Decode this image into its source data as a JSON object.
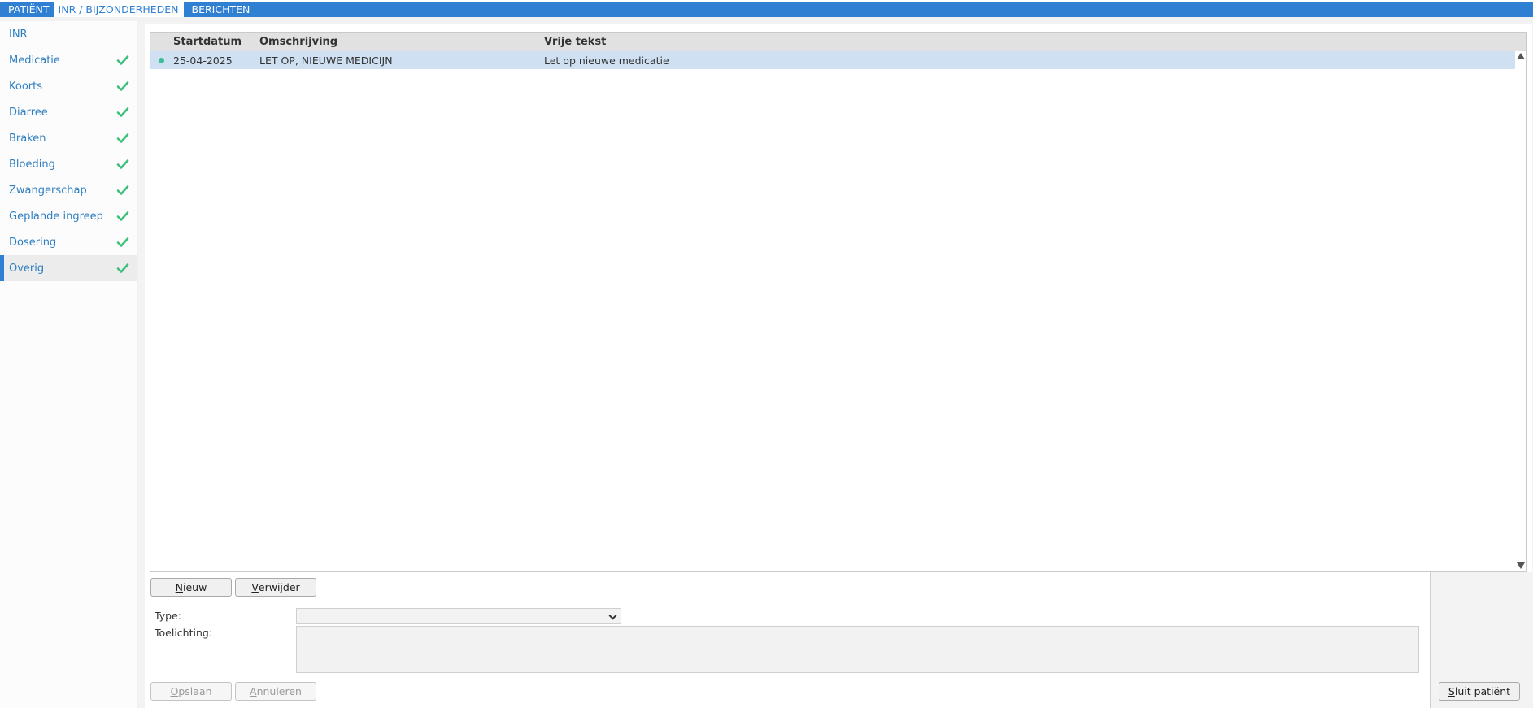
{
  "tabs": [
    {
      "label": "PATIËNT"
    },
    {
      "label": "INR / BIJZONDERHEDEN"
    },
    {
      "label": "BERICHTEN"
    }
  ],
  "sidebar": {
    "items": [
      {
        "label": "INR",
        "checked": false
      },
      {
        "label": "Medicatie",
        "checked": true
      },
      {
        "label": "Koorts",
        "checked": true
      },
      {
        "label": "Diarree",
        "checked": true
      },
      {
        "label": "Braken",
        "checked": true
      },
      {
        "label": "Bloeding",
        "checked": true
      },
      {
        "label": "Zwangerschap",
        "checked": true
      },
      {
        "label": "Geplande ingreep",
        "checked": true
      },
      {
        "label": "Dosering",
        "checked": true
      },
      {
        "label": "Overig",
        "checked": true,
        "active": true
      }
    ]
  },
  "grid": {
    "columns": [
      "Startdatum",
      "Omschrijving",
      "Vrije tekst"
    ],
    "rows": [
      {
        "startdatum": "25-04-2025",
        "omschrijving": "LET OP, NIEUWE MEDICIJN",
        "vrije_tekst": "Let op nieuwe medicatie"
      }
    ]
  },
  "buttons": {
    "nieuw": {
      "first": "N",
      "rest": "ieuw"
    },
    "verwijder": {
      "first": "V",
      "rest": "erwijder"
    },
    "opslaan": {
      "first": "O",
      "rest": "pslaan"
    },
    "annuleren": {
      "first": "A",
      "rest": "nnuleren"
    },
    "sluit": {
      "first": "S",
      "rest": "luit patiënt"
    }
  },
  "form": {
    "type_label": "Type:",
    "type_value": "",
    "toelichting_label": "Toelichting:",
    "toelichting_value": ""
  },
  "colors": {
    "accent": "#2f7fd3",
    "check": "#3bbf7a",
    "selected_row": "#cfe0f3"
  }
}
